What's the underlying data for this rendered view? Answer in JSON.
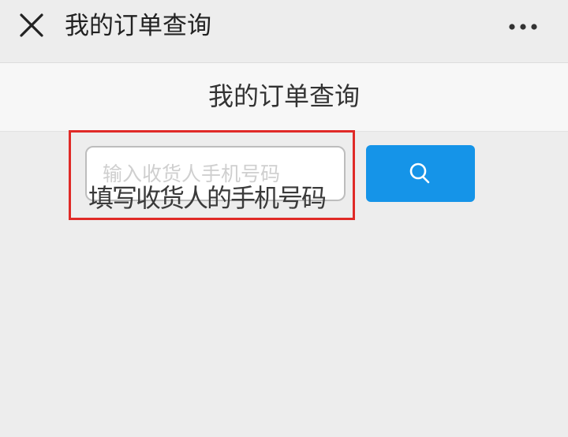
{
  "window": {
    "title": "我的订单查询",
    "close_icon": "close-icon",
    "more_icon": "more-horizontal-icon"
  },
  "page": {
    "header_title": "我的订单查询"
  },
  "search": {
    "placeholder": "输入收货人手机号码",
    "value": "",
    "button_icon": "search-icon",
    "button_color": "#1594e8"
  },
  "annotation": {
    "text": "填写收货人的手机号码",
    "box_color": "#e02a27"
  }
}
